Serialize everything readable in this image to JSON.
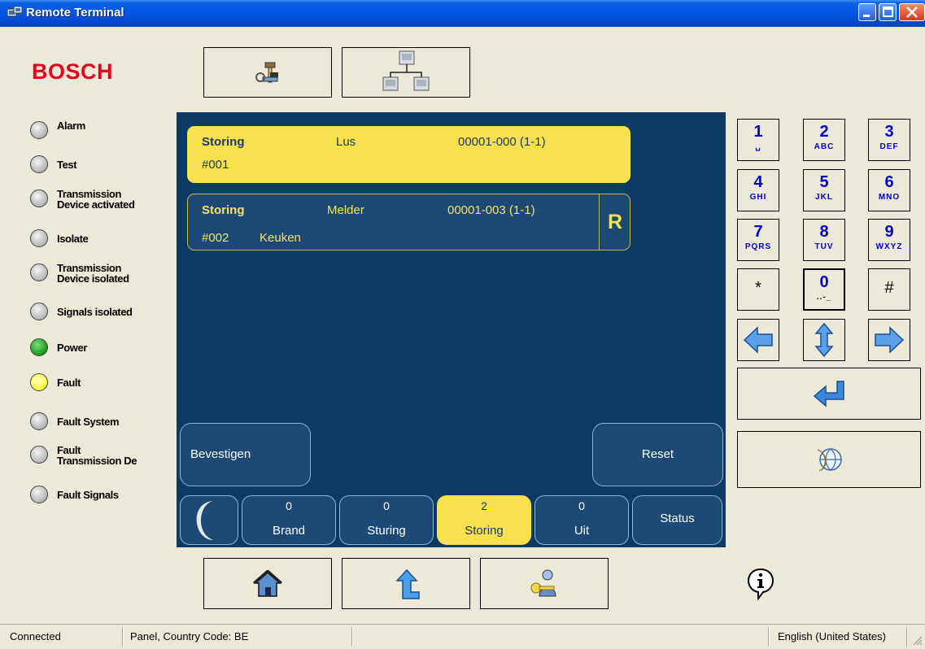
{
  "window": {
    "title": "Remote Terminal"
  },
  "brand": {
    "logo_text": "BOSCH",
    "logo_color": "#e8001c"
  },
  "leds": [
    {
      "label": "Alarm",
      "state": "off"
    },
    {
      "label": "Test",
      "state": "off"
    },
    {
      "label_line1": "Transmission",
      "label_line2": "Device activated",
      "state": "off"
    },
    {
      "label": "Isolate",
      "state": "off"
    },
    {
      "label_line1": "Transmission",
      "label_line2": "Device isolated",
      "state": "off"
    },
    {
      "label": "Signals isolated",
      "state": "off"
    },
    {
      "label": "Power",
      "state": "green"
    },
    {
      "label": "Fault",
      "state": "yellow"
    },
    {
      "label": "Fault System",
      "state": "off"
    },
    {
      "label_line1": "Fault",
      "label_line2": "Transmission De",
      "state": "off"
    },
    {
      "label": "Fault Signals",
      "state": "off"
    }
  ],
  "top_toolbar": {
    "buttons": [
      "tools-icon",
      "network-icon"
    ]
  },
  "messages": [
    {
      "type": "Storing",
      "device": "Lus",
      "address": "00001-000 (1-1)",
      "number": "#001",
      "location": "",
      "selected": true
    },
    {
      "type": "Storing",
      "device": "Melder",
      "address": "00001-003 (1-1)",
      "number": "#002",
      "location": "Keuken",
      "flag": "R",
      "selected": false
    }
  ],
  "actions": {
    "confirm": "Bevestigen",
    "reset": "Reset"
  },
  "tabs": [
    {
      "count": "0",
      "label": "Brand"
    },
    {
      "count": "0",
      "label": "Sturing"
    },
    {
      "count": "2",
      "label": "Storing",
      "active": true
    },
    {
      "count": "0",
      "label": "Uit"
    },
    {
      "label": "Status"
    }
  ],
  "keypad": [
    {
      "num": "1",
      "sub": "␣"
    },
    {
      "num": "2",
      "sub": "ABC"
    },
    {
      "num": "3",
      "sub": "DEF"
    },
    {
      "num": "4",
      "sub": "GHI"
    },
    {
      "num": "5",
      "sub": "JKL"
    },
    {
      "num": "6",
      "sub": "MNO"
    },
    {
      "num": "7",
      "sub": "PQRS"
    },
    {
      "num": "8",
      "sub": "TUV"
    },
    {
      "num": "9",
      "sub": "WXYZ"
    },
    {
      "sym": "*"
    },
    {
      "num": "0",
      "sub": "..-_"
    },
    {
      "sym": "#"
    }
  ],
  "bottom_toolbar": {
    "buttons": [
      "home-icon",
      "up-arrow-icon",
      "user-key-icon"
    ]
  },
  "statusbar": {
    "connection": "Connected",
    "panel": "Panel, Country Code: BE",
    "language": "English (United States)"
  },
  "colors": {
    "display_bg": "#0d3a64",
    "selected_row": "#f8e04e",
    "accent_text": "#f6e06a",
    "window_bg": "#ece9d8"
  }
}
